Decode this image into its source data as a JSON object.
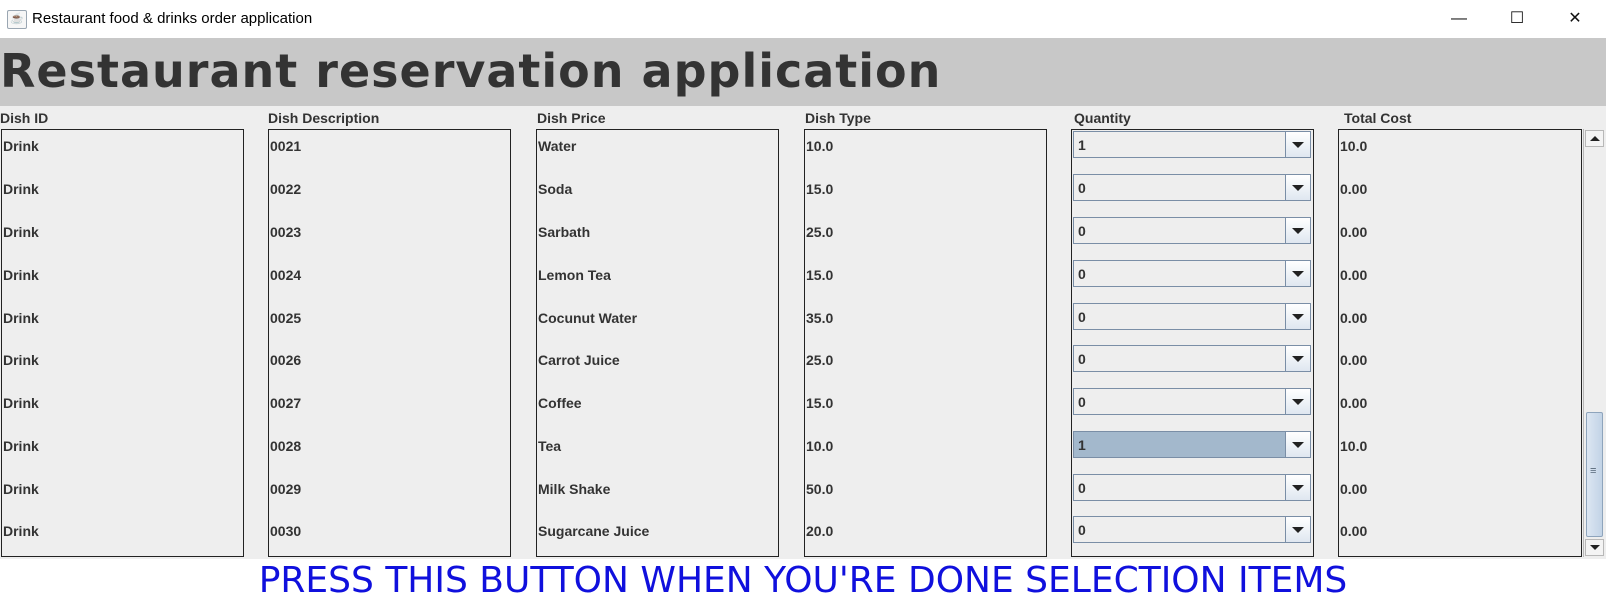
{
  "window": {
    "title": "Restaurant food & drinks order application",
    "minimize_glyph": "—",
    "maximize_glyph": "☐",
    "close_glyph": "✕"
  },
  "header": {
    "title": "Restaurant reservation application"
  },
  "columns": [
    "Dish ID",
    "Dish Description",
    "Dish Price",
    "Dish Type",
    "Quantity",
    "Total Cost"
  ],
  "rows": [
    {
      "c1": "Drink",
      "c2": "0021",
      "c3": "Water",
      "c4": "10.0",
      "qty": "1",
      "total": "10.0"
    },
    {
      "c1": "Drink",
      "c2": "0022",
      "c3": "Soda",
      "c4": "15.0",
      "qty": "0",
      "total": "0.00"
    },
    {
      "c1": "Drink",
      "c2": "0023",
      "c3": "Sarbath",
      "c4": "25.0",
      "qty": "0",
      "total": "0.00"
    },
    {
      "c1": "Drink",
      "c2": "0024",
      "c3": "Lemon Tea",
      "c4": "15.0",
      "qty": "0",
      "total": "0.00"
    },
    {
      "c1": "Drink",
      "c2": "0025",
      "c3": "Cocunut Water",
      "c4": "35.0",
      "qty": "0",
      "total": "0.00"
    },
    {
      "c1": "Drink",
      "c2": "0026",
      "c3": "Carrot Juice",
      "c4": "25.0",
      "qty": "0",
      "total": "0.00"
    },
    {
      "c1": "Drink",
      "c2": "0027",
      "c3": "Coffee",
      "c4": "15.0",
      "qty": "0",
      "total": "0.00"
    },
    {
      "c1": "Drink",
      "c2": "0028",
      "c3": "Tea",
      "c4": "10.0",
      "qty": "1",
      "total": "10.0",
      "selected": true
    },
    {
      "c1": "Drink",
      "c2": "0029",
      "c3": "Milk Shake",
      "c4": "50.0",
      "qty": "0",
      "total": "0.00"
    },
    {
      "c1": "Drink",
      "c2": "0030",
      "c3": "Sugarcane Juice",
      "c4": "20.0",
      "qty": "0",
      "total": "0.00"
    }
  ],
  "done_button": {
    "label": "PRESS THIS BUTTON WHEN YOU'RE DONE SELECTION ITEMS"
  },
  "colors": {
    "header_bg": "#c8c8c8",
    "header_text": "#333333",
    "button_text": "#1010dd",
    "selected_combo": "#a3b8cc"
  }
}
